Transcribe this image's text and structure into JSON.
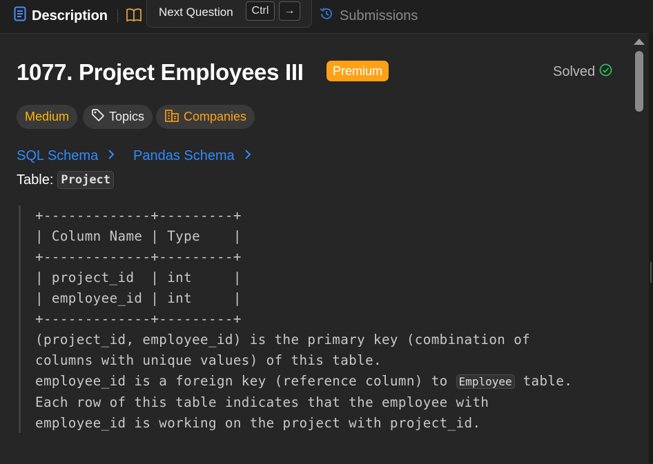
{
  "tabs": {
    "description": "Description",
    "submissions": "Submissions"
  },
  "tooltip": {
    "label": "Next Question",
    "key1": "Ctrl",
    "key2": "→"
  },
  "problem": {
    "title": "1077. Project Employees III",
    "premium_badge": "Premium",
    "status": "Solved"
  },
  "pills": {
    "difficulty": "Medium",
    "topics": "Topics",
    "companies": "Companies"
  },
  "schema_links": {
    "sql": "SQL Schema",
    "pandas": "Pandas Schema"
  },
  "table_label": "Table:",
  "table_name": "Project",
  "schema_block": {
    "border": "+-------------+---------+",
    "header": "| Column Name | Type    |",
    "rows": [
      "| project_id  | int     |",
      "| employee_id | int     |"
    ],
    "desc_1": "(project_id, employee_id) is the primary key (combination of",
    "desc_2": "columns with unique values) of this table.",
    "desc_3a": "employee_id is a foreign key (reference column) to ",
    "desc_3_chip": "Employee",
    "desc_3b": " table.",
    "desc_4": "Each row of this table indicates that the employee with",
    "desc_5": "employee_id is working on the project with project_id."
  },
  "colors": {
    "accent": "#ffa116",
    "link": "#2f8cff",
    "medium": "#ffb800",
    "solved": "#2cbb5d",
    "description_icon": "#4c8df6"
  },
  "icons": {
    "description": "document-icon",
    "book": "book-icon",
    "submissions": "history-icon",
    "solved": "check-circle-icon",
    "topics": "tag-icon",
    "companies": "building-icon",
    "chevron": "chevron-right-icon"
  }
}
